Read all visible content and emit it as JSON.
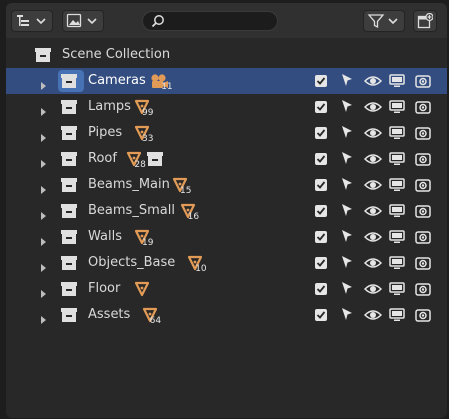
{
  "outliner": {
    "search": {
      "value": "",
      "placeholder": ""
    },
    "scene_collection": {
      "label": "Scene Collection"
    },
    "collections": [
      {
        "label": "Cameras",
        "child_icon": "camera-data-icon",
        "count": "11",
        "selected": true
      },
      {
        "label": "Lamps",
        "child_icon": "mesh-icon",
        "count": "99"
      },
      {
        "label": "Pipes",
        "child_icon": "mesh-icon",
        "count": "33"
      },
      {
        "label": "Roof",
        "child_icon": "mesh-icon",
        "count": "28",
        "extra_icon": "collection-icon"
      },
      {
        "label": "Beams_Main",
        "child_icon": "mesh-icon",
        "count": "15"
      },
      {
        "label": "Beams_Small",
        "child_icon": "mesh-icon",
        "count": "16"
      },
      {
        "label": "Walls",
        "child_icon": "mesh-icon",
        "count": "19"
      },
      {
        "label": "Objects_Base",
        "child_icon": "mesh-icon",
        "count": "10"
      },
      {
        "label": "Floor",
        "child_icon": "mesh-icon",
        "count": ""
      },
      {
        "label": "Assets",
        "child_icon": "mesh-icon",
        "count": "64"
      }
    ],
    "row_controls": [
      "exclude-checkbox-icon",
      "selectable-arrow-icon",
      "eye-icon",
      "monitor-icon",
      "camera-render-icon"
    ],
    "colors": {
      "accent_selected_row": "#334d80",
      "mesh_icon": "#e29b57",
      "camera_icon": "#e29b57"
    }
  }
}
